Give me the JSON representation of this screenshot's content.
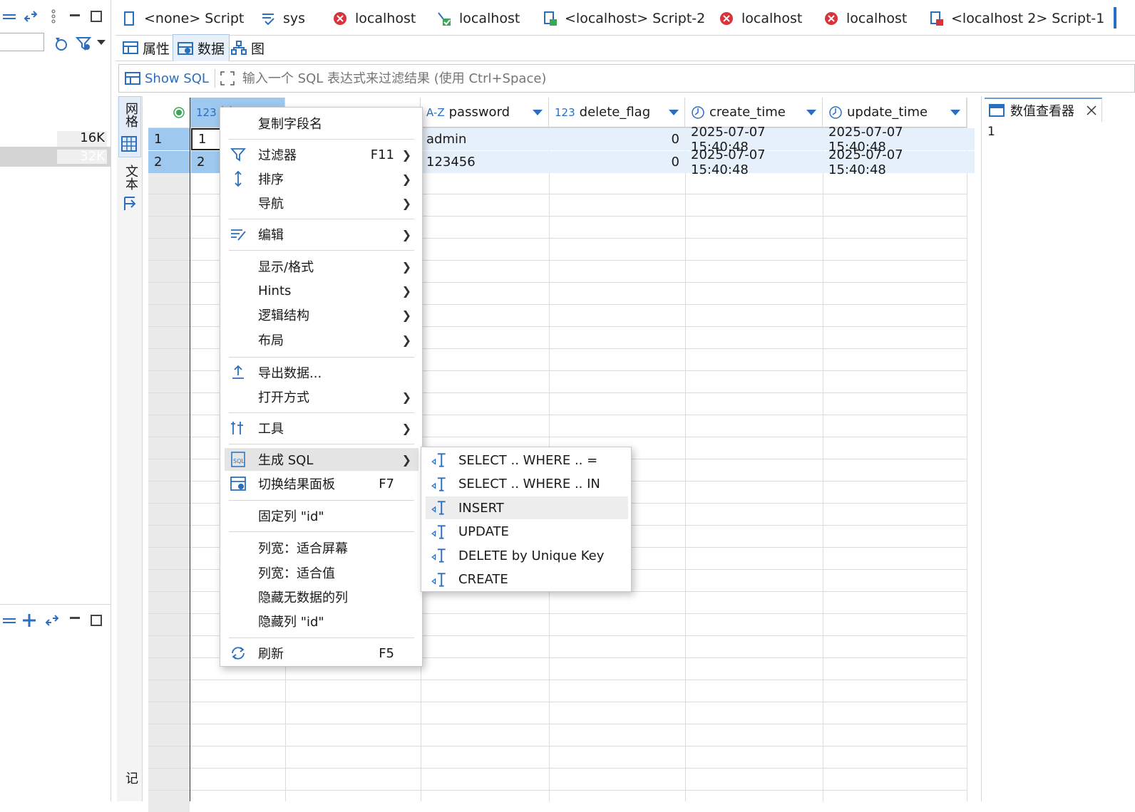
{
  "left_panel": {
    "stat_1": "16K",
    "stat_2": "32K"
  },
  "tabs": [
    {
      "label": "<none> Script",
      "icon": "script-icon"
    },
    {
      "label": "sys",
      "icon": "sys-icon"
    },
    {
      "label": "localhost",
      "icon": "error-icon"
    },
    {
      "label": "localhost",
      "icon": "connected-icon"
    },
    {
      "label": "<localhost> Script-2",
      "icon": "script-connected-icon"
    },
    {
      "label": "localhost",
      "icon": "error-icon"
    },
    {
      "label": "localhost",
      "icon": "error-icon"
    },
    {
      "label": "<localhost 2> Script-1",
      "icon": "script-error-icon"
    }
  ],
  "subtabs": [
    {
      "label": "属性"
    },
    {
      "label": "数据"
    },
    {
      "label": "图"
    }
  ],
  "filter": {
    "show_sql": "Show SQL",
    "placeholder": "输入一个 SQL 表达式来过滤结果 (使用 Ctrl+Space)"
  },
  "vbar": {
    "grid_label": "网格",
    "text_label": "文本",
    "bottom_label": "记"
  },
  "grid": {
    "columns": [
      {
        "type": "123",
        "name": "id"
      },
      {
        "type": "A-Z",
        "name": "password"
      },
      {
        "type": "123",
        "name": "delete_flag"
      },
      {
        "type": "clock",
        "name": "create_time"
      },
      {
        "type": "clock",
        "name": "update_time"
      }
    ],
    "rows": [
      {
        "num": "1",
        "id": "1",
        "password": "admin",
        "delete_flag": "0",
        "create_time": "2025-07-07 15:40:48",
        "update_time": "2025-07-07 15:40:48"
      },
      {
        "num": "2",
        "id": "2",
        "password": "123456",
        "delete_flag": "0",
        "create_time": "2025-07-07 15:40:48",
        "update_time": "2025-07-07 15:40:48"
      }
    ]
  },
  "viewer": {
    "title": "数值查看器",
    "value": "1"
  },
  "context_menu": [
    {
      "label": "复制字段名",
      "key": "",
      "sub": false,
      "icon": ""
    },
    {
      "label": "过滤器",
      "key": "F11",
      "sub": true,
      "icon": "filter-icon"
    },
    {
      "label": "排序",
      "key": "",
      "sub": true,
      "icon": "sort-icon"
    },
    {
      "label": "导航",
      "key": "",
      "sub": true,
      "icon": ""
    },
    {
      "label": "编辑",
      "key": "",
      "sub": true,
      "icon": "edit-icon"
    },
    {
      "label": "显示/格式",
      "key": "",
      "sub": true,
      "icon": ""
    },
    {
      "label": "Hints",
      "key": "",
      "sub": true,
      "icon": ""
    },
    {
      "label": "逻辑结构",
      "key": "",
      "sub": true,
      "icon": ""
    },
    {
      "label": "布局",
      "key": "",
      "sub": true,
      "icon": ""
    },
    {
      "label": "导出数据...",
      "key": "",
      "sub": false,
      "icon": "export-icon"
    },
    {
      "label": "打开方式",
      "key": "",
      "sub": true,
      "icon": ""
    },
    {
      "label": "工具",
      "key": "",
      "sub": true,
      "icon": "tools-icon"
    },
    {
      "label": "生成 SQL",
      "key": "",
      "sub": true,
      "icon": "sql-icon"
    },
    {
      "label": "切换结果面板",
      "key": "F7",
      "sub": false,
      "icon": "panel-toggle-icon"
    },
    {
      "label": "固定列 \"id\"",
      "key": "",
      "sub": false,
      "icon": ""
    },
    {
      "label": "列宽：适合屏幕",
      "key": "",
      "sub": false,
      "icon": ""
    },
    {
      "label": "列宽：适合值",
      "key": "",
      "sub": false,
      "icon": ""
    },
    {
      "label": "隐藏无数据的列",
      "key": "",
      "sub": false,
      "icon": ""
    },
    {
      "label": "隐藏列 \"id\"",
      "key": "",
      "sub": false,
      "icon": ""
    },
    {
      "label": "刷新",
      "key": "F5",
      "sub": false,
      "icon": "refresh-icon"
    }
  ],
  "submenu": [
    {
      "label": "SELECT .. WHERE .. ="
    },
    {
      "label": "SELECT .. WHERE .. IN"
    },
    {
      "label": "INSERT"
    },
    {
      "label": "UPDATE"
    },
    {
      "label": "DELETE by Unique Key"
    },
    {
      "label": "CREATE"
    }
  ],
  "colors": {
    "accent": "#2a6fbf",
    "rownum": "#9fc8ef",
    "selected_row": "#e6f0fb"
  }
}
